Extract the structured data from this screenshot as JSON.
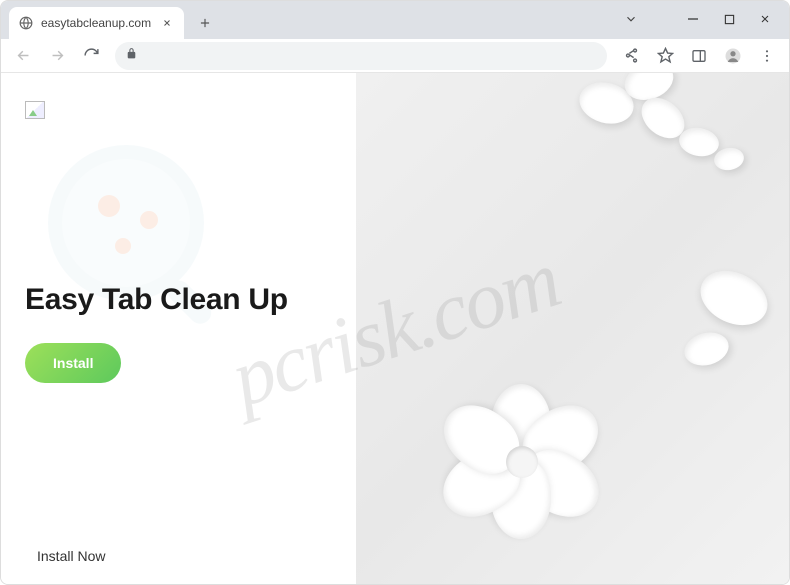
{
  "browser": {
    "tab_title": "easytabcleanup.com",
    "url": "",
    "url_placeholder": ""
  },
  "page": {
    "headline": "Easy Tab Clean Up",
    "install_button": "Install",
    "footer_link": "Install Now"
  },
  "icons": {
    "globe": "globe-icon",
    "close": "close-icon",
    "plus": "plus-icon",
    "minimize": "minimize-icon",
    "maximize": "maximize-icon",
    "window_close": "close-window-icon",
    "chevron_down": "chevron-down-icon",
    "back": "back-icon",
    "forward": "forward-icon",
    "reload": "reload-icon",
    "lock": "lock-icon",
    "share": "share-icon",
    "star": "star-icon",
    "panel": "side-panel-icon",
    "avatar": "avatar-icon",
    "kebab": "kebab-menu-icon"
  },
  "watermark": "pcrisk.com"
}
